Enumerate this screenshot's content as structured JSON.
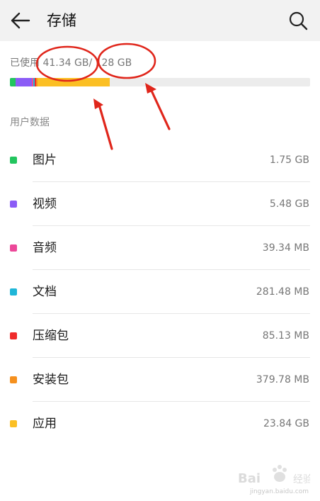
{
  "header": {
    "title": "存储",
    "back_icon": "back-arrow-icon",
    "search_icon": "search-icon"
  },
  "storage": {
    "used_label": "已使用",
    "used_value": "41.34 GB",
    "separator": "/",
    "total_value": "128 GB",
    "used_fraction": 0.323
  },
  "section": {
    "title": "用户数据"
  },
  "categories": [
    {
      "label": "图片",
      "size": "1.75 GB",
      "color": "#22c55e"
    },
    {
      "label": "视频",
      "size": "5.48 GB",
      "color": "#8b5cf6"
    },
    {
      "label": "音频",
      "size": "39.34 MB",
      "color": "#ec4899"
    },
    {
      "label": "文档",
      "size": "281.48 MB",
      "color": "#1fb6d8"
    },
    {
      "label": "压缩包",
      "size": "85.13 MB",
      "color": "#ef2b2b"
    },
    {
      "label": "安装包",
      "size": "379.78 MB",
      "color": "#f5901e"
    },
    {
      "label": "应用",
      "size": "23.84 GB",
      "color": "#fbbf24"
    }
  ],
  "annotation": {
    "color": "#e0261b"
  },
  "watermark": {
    "brand": "Baidu经验",
    "url": "jingyan.baidu.com"
  }
}
